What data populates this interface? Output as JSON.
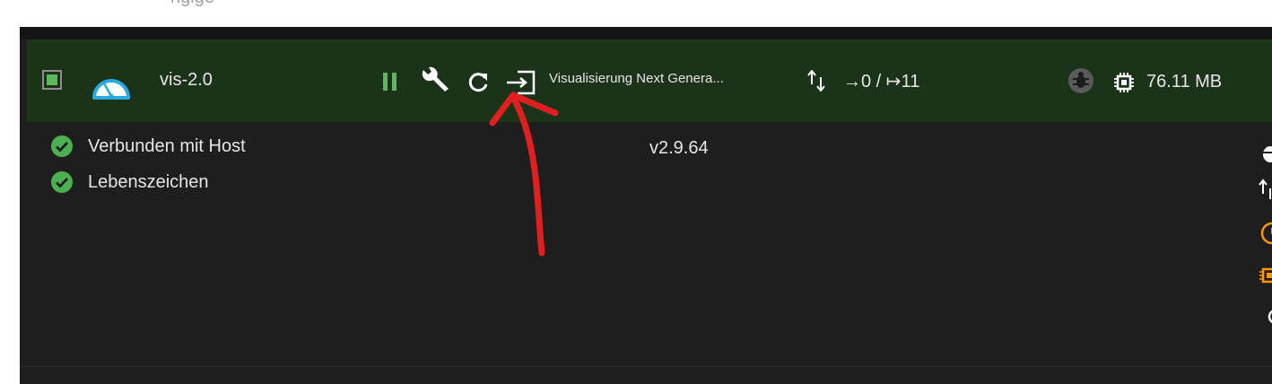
{
  "top_text": "ngige",
  "instance": {
    "adapter_name": "vis-2.0",
    "title": "Visualisierung Next Genera...",
    "counts": "→0 / ↦11",
    "memory": "76.11 MB",
    "version": "v2.9.64",
    "enabled": true
  },
  "status": {
    "connected_label": "Verbunden mit Host",
    "alive_label": "Lebenszeichen"
  },
  "colors": {
    "header_bg": "#1b3419",
    "panel_bg": "#1e1e1e",
    "ok_green": "#4caf50",
    "pause_green": "#5cb85c",
    "adapter_blue": "#29a8e0",
    "warning_orange": "#ff9800",
    "annotation_red": "#e02020"
  },
  "icons": {
    "adapter": "gauge-icon",
    "pause": "pause-icon",
    "settings": "wrench-icon",
    "reload": "reload-icon",
    "open": "login-icon",
    "transfer": "arrows-up-down-icon",
    "debug": "bug-icon",
    "memory": "chip-icon",
    "status": "check-circle-icon"
  }
}
